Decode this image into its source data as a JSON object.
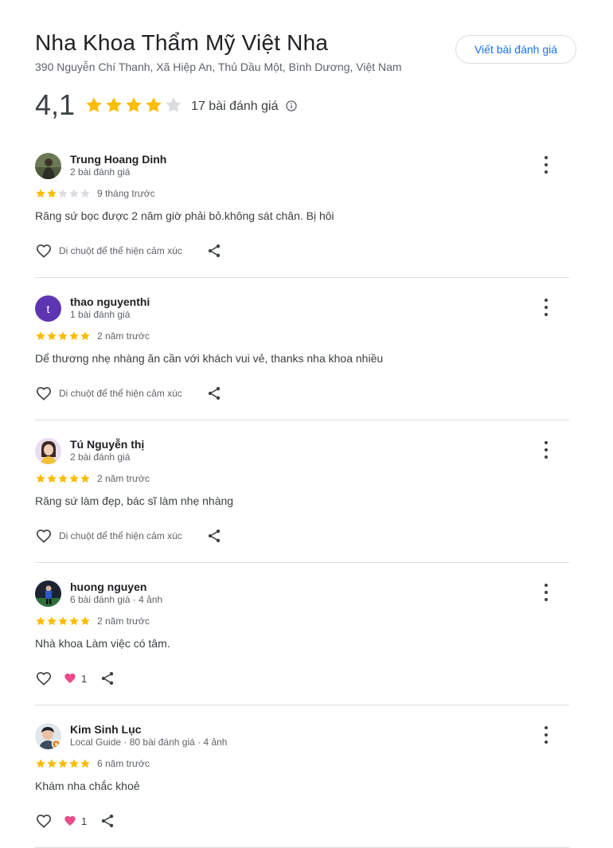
{
  "header": {
    "title": "Nha Khoa Thẩm Mỹ Việt Nha",
    "address": "390 Nguyễn Chí Thanh, Xã Hiệp An, Thủ Dầu Một, Bình Dương, Việt Nam",
    "write_review_label": "Viết bài đánh giá"
  },
  "summary": {
    "rating": "4,1",
    "stars_filled": 4,
    "review_count": "17 bài đánh giá"
  },
  "colors": {
    "star_filled": "#fbbc04",
    "star_empty": "#dadce0",
    "link": "#1a73e8",
    "heart_reaction": "#ea4c89"
  },
  "reviews": [
    {
      "author": "Trung Hoang Dinh",
      "meta": "2 bài đánh giá",
      "stars": 2,
      "date": "9 tháng trước",
      "text": "Răng sứ bọc được 2 năm giờ phải bỏ.không sát chân. Bị hôi",
      "reaction_hint": "Di chuột để thể hiện cảm xúc",
      "avatar_icon": "photo-avatar-outdoor"
    },
    {
      "author": "thao nguyenthi",
      "meta": "1 bài đánh giá",
      "stars": 5,
      "date": "2 năm trước",
      "text": "Dể thương nhẹ nhàng ăn cần với khách vui vẻ, thanks nha khoa nhiều",
      "reaction_hint": "Di chuột để thể hiện cảm xúc",
      "avatar_letter": "t"
    },
    {
      "author": "Tú Nguyễn thị",
      "meta": "2 bài đánh giá",
      "stars": 5,
      "date": "2 năm trước",
      "text": "Răng sứ làm đẹp, bác sĩ làm nhẹ nhàng",
      "reaction_hint": "Di chuột để thể hiện cảm xúc",
      "avatar_icon": "photo-avatar-portrait"
    },
    {
      "author": "huong nguyen",
      "meta": "6 bài đánh giá · 4 ảnh",
      "stars": 5,
      "date": "2 năm trước",
      "text": "Nhà khoa Làm việc có tâm.",
      "reaction_count": "1",
      "avatar_icon": "photo-avatar-sport"
    },
    {
      "author": "Kim Sinh Lục",
      "meta": "Local Guide · 80 bài đánh giá · 4 ảnh",
      "stars": 5,
      "date": "6 năm trước",
      "text": "Khám nha chắc khoẻ",
      "reaction_count": "1",
      "avatar_icon": "photo-avatar-local-guide"
    }
  ]
}
